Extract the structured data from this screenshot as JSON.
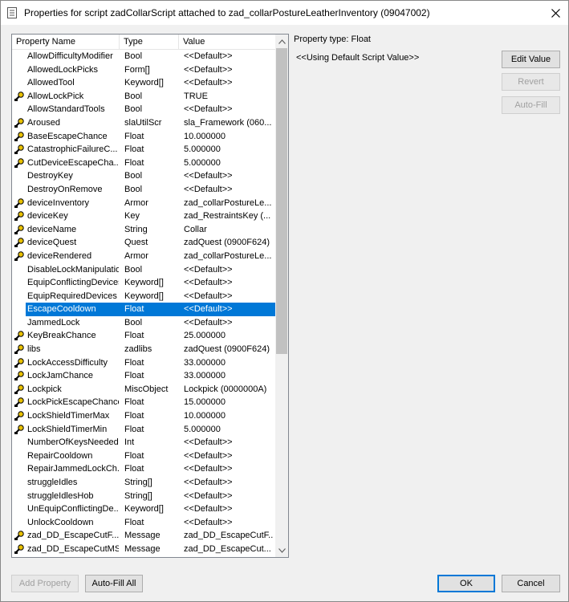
{
  "window": {
    "title": "Properties for script zadCollarScript attached to zad_collarPostureLeatherInventory (09047002)"
  },
  "list": {
    "columns": [
      "Property Name",
      "Type",
      "Value"
    ],
    "rows": [
      {
        "name": "AllowDifficultyModifier",
        "type": "Bool",
        "value": "<<Default>>",
        "icon": false
      },
      {
        "name": "AllowedLockPicks",
        "type": "Form[]",
        "value": "<<Default>>",
        "icon": false
      },
      {
        "name": "AllowedTool",
        "type": "Keyword[]",
        "value": "<<Default>>",
        "icon": false
      },
      {
        "name": "AllowLockPick",
        "type": "Bool",
        "value": "TRUE",
        "icon": true
      },
      {
        "name": "AllowStandardTools",
        "type": "Bool",
        "value": "<<Default>>",
        "icon": false
      },
      {
        "name": "Aroused",
        "type": "slaUtilScr",
        "value": "sla_Framework (060...",
        "icon": true
      },
      {
        "name": "BaseEscapeChance",
        "type": "Float",
        "value": "10.000000",
        "icon": true
      },
      {
        "name": "CatastrophicFailureC...",
        "type": "Float",
        "value": "5.000000",
        "icon": true
      },
      {
        "name": "CutDeviceEscapeCha...",
        "type": "Float",
        "value": "5.000000",
        "icon": true
      },
      {
        "name": "DestroyKey",
        "type": "Bool",
        "value": "<<Default>>",
        "icon": false
      },
      {
        "name": "DestroyOnRemove",
        "type": "Bool",
        "value": "<<Default>>",
        "icon": false
      },
      {
        "name": "deviceInventory",
        "type": "Armor",
        "value": "zad_collarPostureLe...",
        "icon": true
      },
      {
        "name": "deviceKey",
        "type": "Key",
        "value": "zad_RestraintsKey (...",
        "icon": true
      },
      {
        "name": "deviceName",
        "type": "String",
        "value": "Collar",
        "icon": true
      },
      {
        "name": "deviceQuest",
        "type": "Quest",
        "value": "zadQuest (0900F624)",
        "icon": true
      },
      {
        "name": "deviceRendered",
        "type": "Armor",
        "value": "zad_collarPostureLe...",
        "icon": true
      },
      {
        "name": "DisableLockManipulation",
        "type": "Bool",
        "value": "<<Default>>",
        "icon": false
      },
      {
        "name": "EquipConflictingDevices",
        "type": "Keyword[]",
        "value": "<<Default>>",
        "icon": false
      },
      {
        "name": "EquipRequiredDevices",
        "type": "Keyword[]",
        "value": "<<Default>>",
        "icon": false
      },
      {
        "name": "EscapeCooldown",
        "type": "Float",
        "value": "<<Default>>",
        "icon": false,
        "selected": true
      },
      {
        "name": "JammedLock",
        "type": "Bool",
        "value": "<<Default>>",
        "icon": false
      },
      {
        "name": "KeyBreakChance",
        "type": "Float",
        "value": "25.000000",
        "icon": true
      },
      {
        "name": "libs",
        "type": "zadlibs",
        "value": "zadQuest (0900F624)",
        "icon": true
      },
      {
        "name": "LockAccessDifficulty",
        "type": "Float",
        "value": "33.000000",
        "icon": true
      },
      {
        "name": "LockJamChance",
        "type": "Float",
        "value": "33.000000",
        "icon": true
      },
      {
        "name": "Lockpick",
        "type": "MiscObject",
        "value": "Lockpick (0000000A)",
        "icon": true
      },
      {
        "name": "LockPickEscapeChance",
        "type": "Float",
        "value": "15.000000",
        "icon": true
      },
      {
        "name": "LockShieldTimerMax",
        "type": "Float",
        "value": "10.000000",
        "icon": true
      },
      {
        "name": "LockShieldTimerMin",
        "type": "Float",
        "value": "5.000000",
        "icon": true
      },
      {
        "name": "NumberOfKeysNeeded",
        "type": "Int",
        "value": "<<Default>>",
        "icon": false
      },
      {
        "name": "RepairCooldown",
        "type": "Float",
        "value": "<<Default>>",
        "icon": false
      },
      {
        "name": "RepairJammedLockCh...",
        "type": "Float",
        "value": "<<Default>>",
        "icon": false
      },
      {
        "name": "struggleIdles",
        "type": "String[]",
        "value": "<<Default>>",
        "icon": false
      },
      {
        "name": "struggleIdlesHob",
        "type": "String[]",
        "value": "<<Default>>",
        "icon": false
      },
      {
        "name": "UnEquipConflictingDe...",
        "type": "Keyword[]",
        "value": "<<Default>>",
        "icon": false
      },
      {
        "name": "UnlockCooldown",
        "type": "Float",
        "value": "<<Default>>",
        "icon": false
      },
      {
        "name": "zad_DD_EscapeCutF...",
        "type": "Message",
        "value": "zad_DD_EscapeCutF...",
        "icon": true
      },
      {
        "name": "zad_DD_EscapeCutMSG",
        "type": "Message",
        "value": "zad_DD_EscapeCut...",
        "icon": true
      }
    ]
  },
  "details": {
    "property_type": "Property type: Float",
    "value_text": "<<Using Default Script Value>>"
  },
  "buttons": {
    "edit_value": "Edit Value",
    "revert": "Revert",
    "auto_fill": "Auto-Fill",
    "add_property": "Add Property",
    "auto_fill_all": "Auto-Fill All",
    "ok": "OK",
    "cancel": "Cancel"
  },
  "icons": {
    "app": "script-app-icon",
    "close": "close-icon",
    "property": "property-filled-icon",
    "scroll_up": "chevron-up-icon",
    "scroll_down": "chevron-down-icon"
  },
  "colors": {
    "selection": "#0078d7",
    "dialog_bg": "#f0f0f0"
  }
}
